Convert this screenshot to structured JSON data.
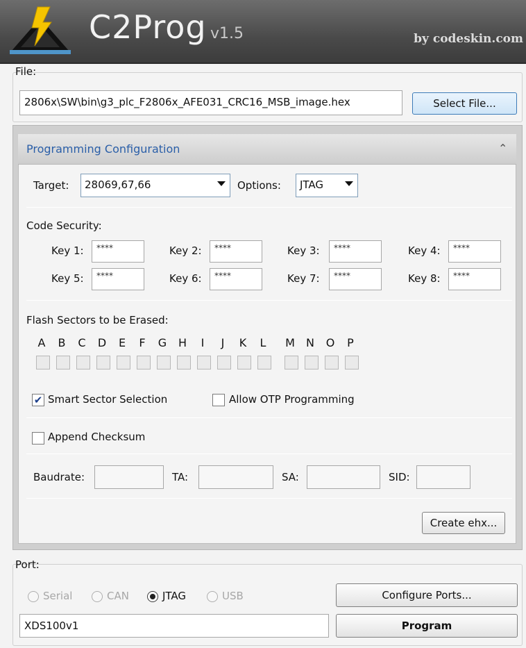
{
  "header": {
    "app_name": "C2Prog",
    "version": "v1.5",
    "vendor": "by codeskin.com",
    "logo_icon": "lightning-pyramid-logo"
  },
  "file_group": {
    "legend": "File:",
    "path": "2806x\\SW\\bin\\g3_plc_F2806x_AFE031_CRC16_MSB_image.hex",
    "select_button": "Select File..."
  },
  "config": {
    "title": "Programming Configuration",
    "collapse_icon": "double-chevron-up-icon",
    "target_label": "Target:",
    "target_value": "28069,67,66",
    "options_label": "Options:",
    "options_value": "JTAG",
    "code_security_label": "Code Security:",
    "keys": [
      {
        "label": "Key 1:",
        "value": "****"
      },
      {
        "label": "Key 2:",
        "value": "****"
      },
      {
        "label": "Key 3:",
        "value": "****"
      },
      {
        "label": "Key 4:",
        "value": "****"
      },
      {
        "label": "Key 5:",
        "value": "****"
      },
      {
        "label": "Key 6:",
        "value": "****"
      },
      {
        "label": "Key 7:",
        "value": "****"
      },
      {
        "label": "Key 8:",
        "value": "****"
      }
    ],
    "flash_sectors_label": "Flash Sectors to be Erased:",
    "sectors": [
      "A",
      "B",
      "C",
      "D",
      "E",
      "F",
      "G",
      "H",
      "I",
      "J",
      "K",
      "L",
      "M",
      "N",
      "O",
      "P"
    ],
    "smart_sector_label": "Smart Sector Selection",
    "smart_sector_checked": true,
    "allow_otp_label": "Allow OTP Programming",
    "allow_otp_checked": false,
    "append_checksum_label": "Append Checksum",
    "append_checksum_checked": false,
    "baudrate_label": "Baudrate:",
    "ta_label": "TA:",
    "sa_label": "SA:",
    "sid_label": "SID:",
    "create_ehx_button": "Create ehx..."
  },
  "port_group": {
    "legend": "Port:",
    "radios": [
      {
        "label": "Serial",
        "selected": false,
        "enabled": false
      },
      {
        "label": "CAN",
        "selected": false,
        "enabled": false
      },
      {
        "label": "JTAG",
        "selected": true,
        "enabled": true
      },
      {
        "label": "USB",
        "selected": false,
        "enabled": false
      }
    ],
    "configure_button": "Configure Ports...",
    "port_value": "XDS100v1",
    "program_button": "Program"
  },
  "colors": {
    "header_bg": "#4a4a4a",
    "accent_blue": "#2b5fa8",
    "logo_yellow": "#f5c400"
  }
}
